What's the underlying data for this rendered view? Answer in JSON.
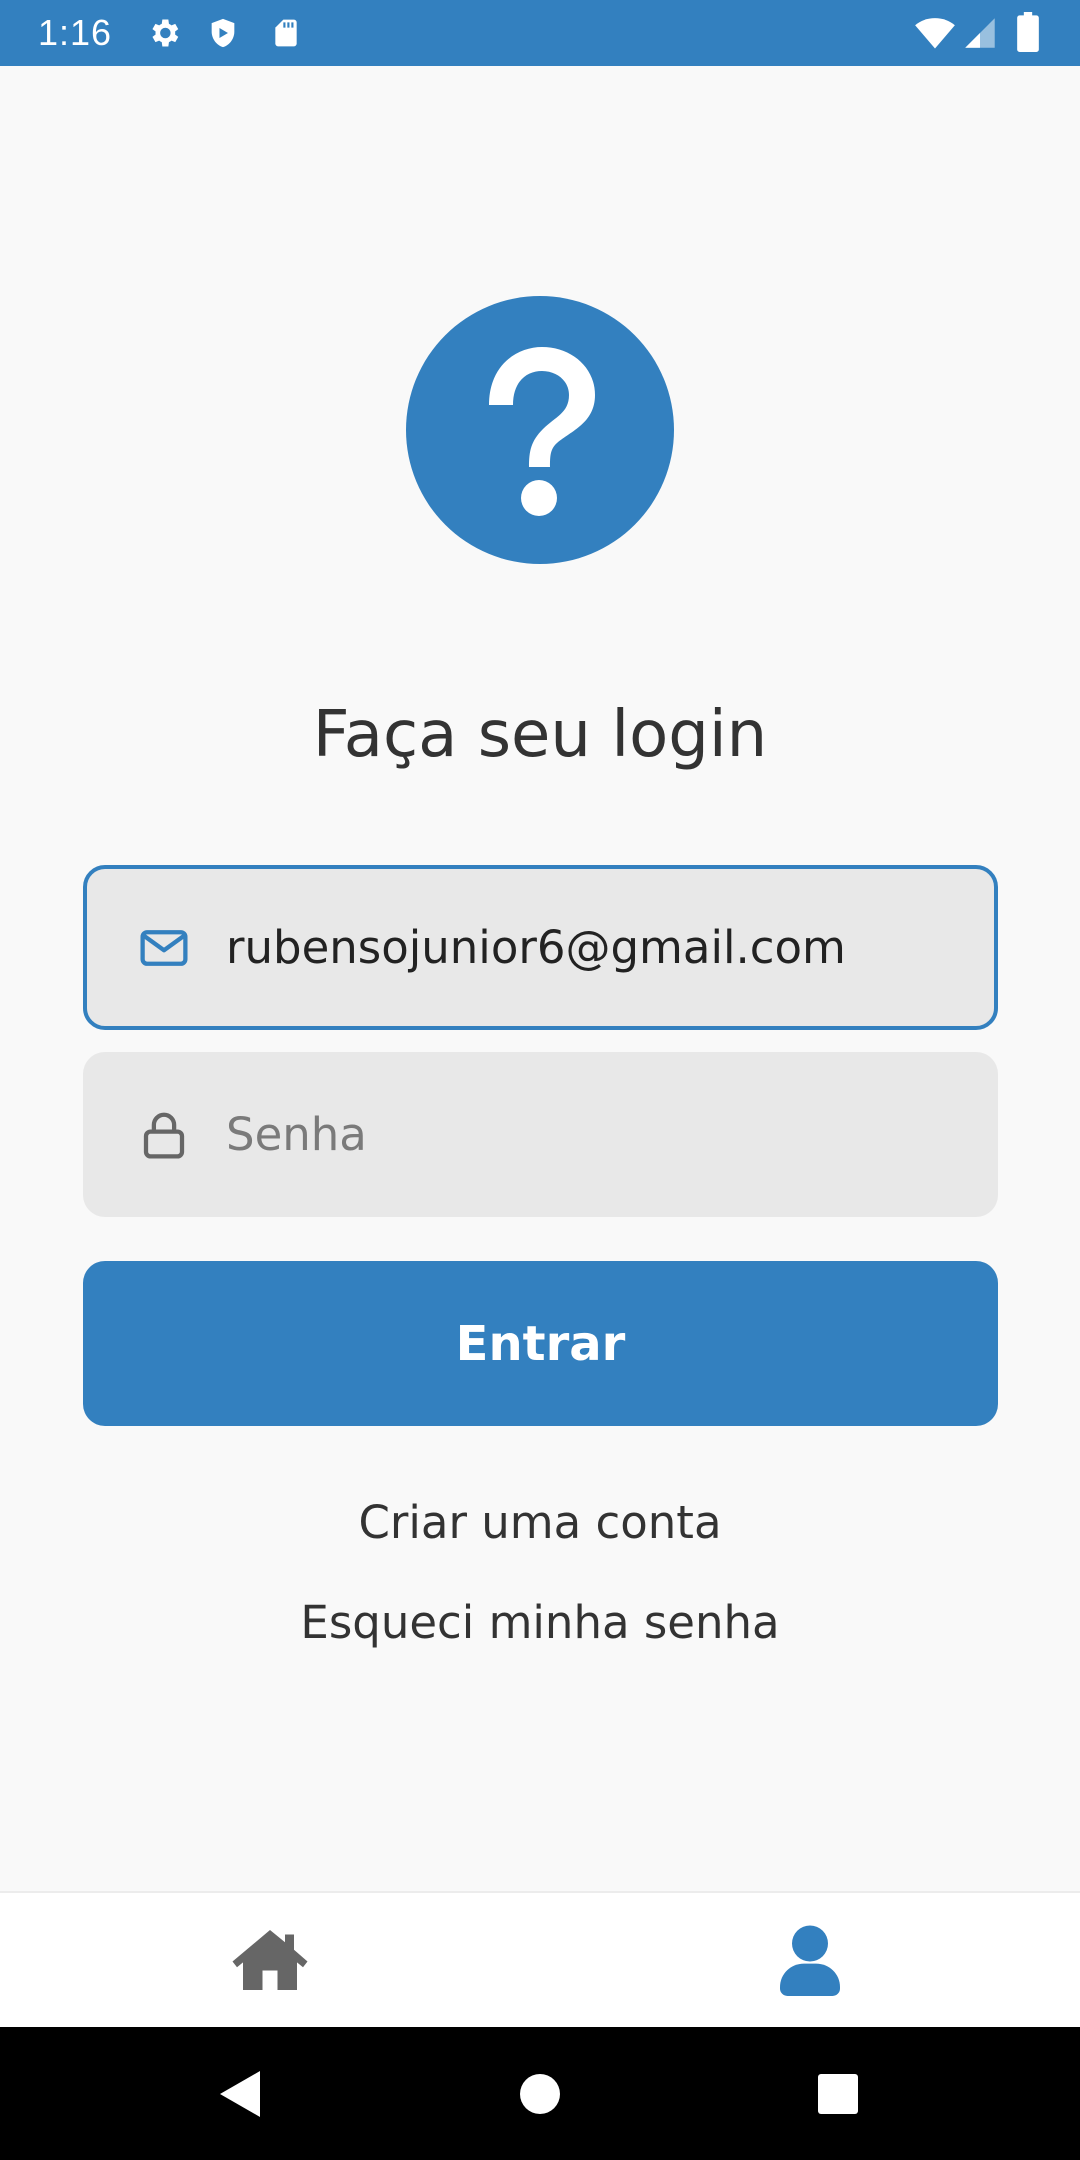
{
  "status_bar": {
    "time": "1:16",
    "icons": [
      "gear-icon",
      "shield-icon",
      "sd-card-icon",
      "wifi-icon",
      "signal-icon",
      "battery-icon"
    ]
  },
  "logo": {
    "icon": "question-mark-icon",
    "color": "#3380bf"
  },
  "login": {
    "title": "Faça seu login",
    "email_value": "rubensojunior6@gmail.com",
    "email_icon": "mail-icon",
    "password_placeholder": "Senha",
    "password_icon": "lock-icon",
    "submit_label": "Entrar",
    "create_account_label": "Criar uma conta",
    "forgot_password_label": "Esqueci minha senha"
  },
  "bottom_nav": {
    "items": [
      {
        "icon": "home-icon",
        "active": false
      },
      {
        "icon": "user-icon",
        "active": true
      }
    ]
  },
  "system_nav": {
    "buttons": [
      "back-icon",
      "home-circle-icon",
      "recents-icon"
    ]
  },
  "colors": {
    "accent": "#3380bf",
    "background": "#f9f9f9",
    "field_background": "#e8e8e8",
    "text": "#333333",
    "inactive_icon": "#666666"
  }
}
